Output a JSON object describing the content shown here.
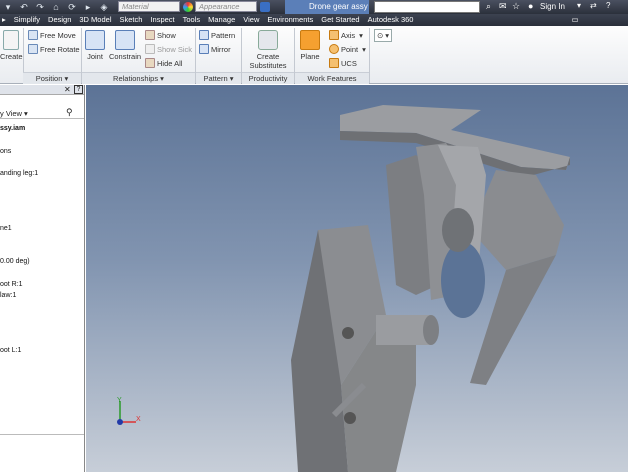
{
  "titlebar": {
    "material_placeholder": "Material",
    "appearance_placeholder": "Appearance",
    "document_tab": "Drone gear assy",
    "sign_in": "Sign In",
    "help": "?"
  },
  "menu_tabs": [
    "Simplify",
    "Design",
    "3D Model",
    "Sketch",
    "Inspect",
    "Tools",
    "Manage",
    "View",
    "Environments",
    "Get Started",
    "Autodesk 360"
  ],
  "ribbon": {
    "create": "Create",
    "free_move": "Free Move",
    "free_rotate": "Free Rotate",
    "joint": "Joint",
    "constrain": "Constrain",
    "show": "Show",
    "show_sick": "Show Sick",
    "hide_all": "Hide All",
    "pattern": "Pattern",
    "mirror": "Mirror",
    "create_substitutes_1": "Create",
    "create_substitutes_2": "Substitutes",
    "plane": "Plane",
    "axis": "Axis",
    "point": "Point",
    "ucs": "UCS",
    "panels": {
      "position": "Position",
      "relationships": "Relationships",
      "pattern": "Pattern",
      "productivity": "Productivity",
      "work_features": "Work Features"
    }
  },
  "browser": {
    "view_label": "y View",
    "root": "ssy.iam",
    "items": [
      "ons",
      "anding leg:1",
      "ne1",
      "0.00 deg)",
      "oot R:1",
      "law:1",
      "oot L:1"
    ]
  },
  "triad": {
    "x_label": "X",
    "y_label": "Y"
  },
  "colors": {
    "accent": "#5b7fb8",
    "viewport_top": "#5c7396",
    "viewport_bottom": "#c7ced8",
    "part_gray": "#8f9195"
  }
}
